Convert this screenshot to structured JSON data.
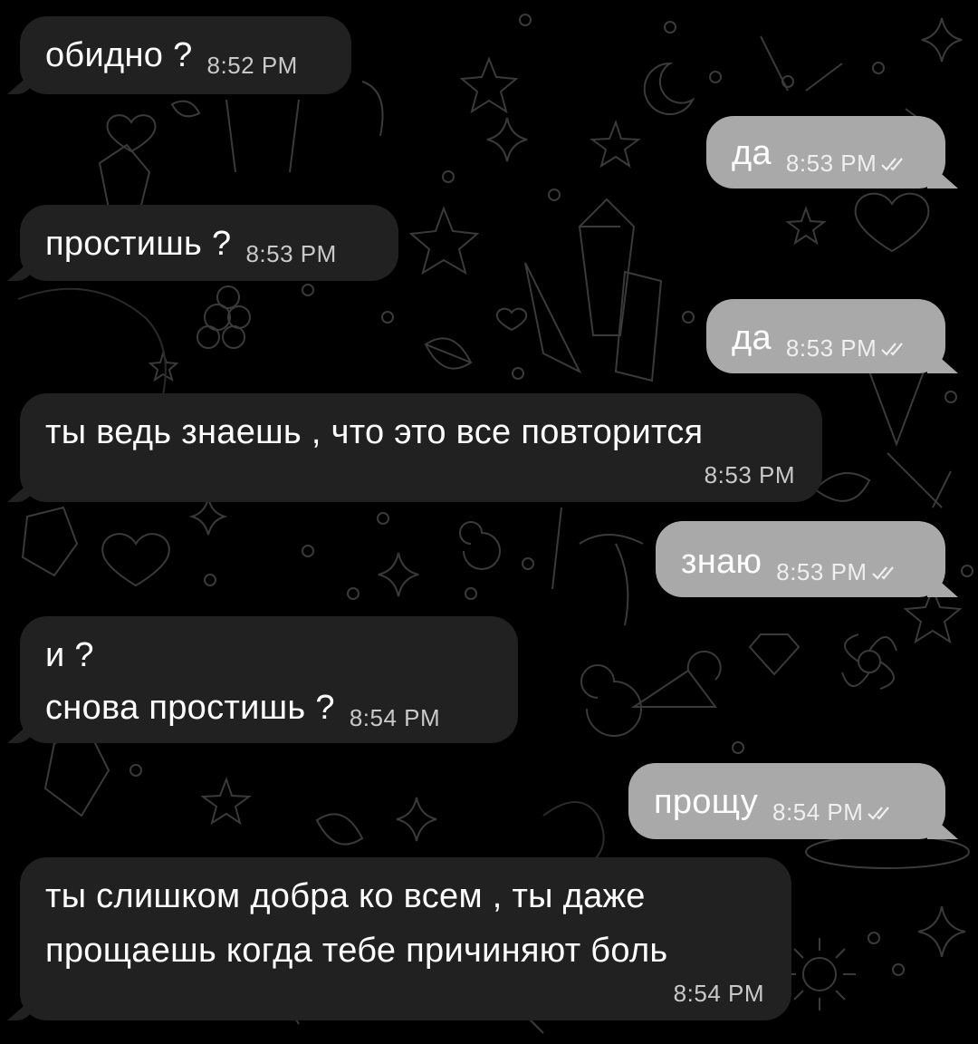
{
  "messages": [
    {
      "dir": "in",
      "text": "обидно ?",
      "time": "8:52 PM"
    },
    {
      "dir": "out",
      "text": "да",
      "time": "8:53 PM"
    },
    {
      "dir": "in",
      "text": "простишь ?",
      "time": "8:53 PM"
    },
    {
      "dir": "out",
      "text": "да",
      "time": "8:53 PM"
    },
    {
      "dir": "in",
      "text": "ты ведь знаешь , что это все повторится",
      "time": "8:53 PM"
    },
    {
      "dir": "out",
      "text": "знаю",
      "time": "8:53 PM"
    },
    {
      "dir": "in",
      "text_line1": "и ?",
      "text_line2": "снова простишь ?",
      "time": "8:54 PM"
    },
    {
      "dir": "out",
      "text": "прощу",
      "time": "8:54 PM"
    },
    {
      "dir": "in",
      "text_line1": "ты слишком добра ко всем , ты даже",
      "text_line2": "прощаешь когда тебе причиняют боль",
      "time": "8:54 PM"
    }
  ],
  "icons": {
    "read_receipt": "double-check-icon",
    "background": "doodle-pattern"
  },
  "colors": {
    "background": "#000000",
    "incoming_bubble": "#212121",
    "outgoing_bubble": "#a9a9a9",
    "text": "#ffffff"
  }
}
